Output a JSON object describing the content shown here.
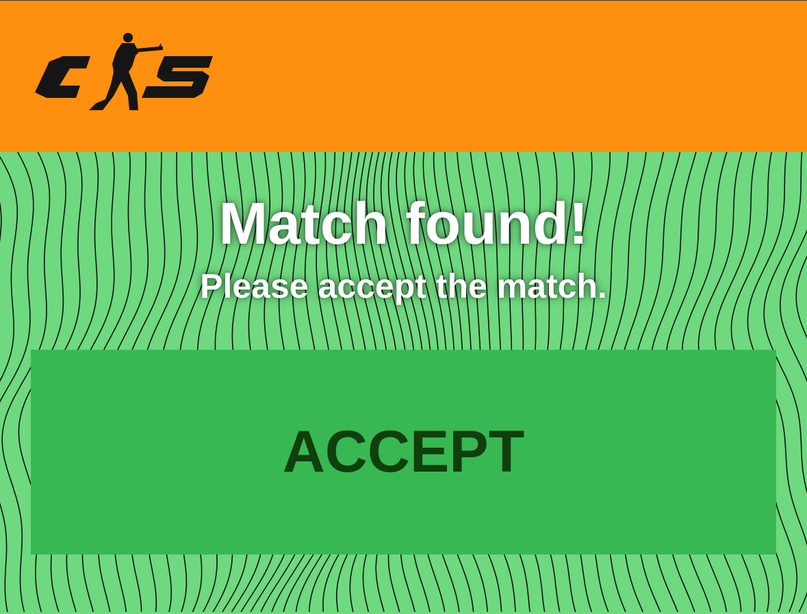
{
  "header": {
    "logo_text": "CS",
    "background_color": "#ff8f0f"
  },
  "icons": {
    "logo": "counter-strike-soldier-logo"
  },
  "main": {
    "title": "Match found!",
    "subtitle": "Please accept the match.",
    "accept_label": "ACCEPT"
  },
  "colors": {
    "page_background": "#6ed97f",
    "wave_lines": "#111111",
    "button_background": "#38b852",
    "button_text": "#0f3f0d",
    "title_text": "#ffffff"
  }
}
